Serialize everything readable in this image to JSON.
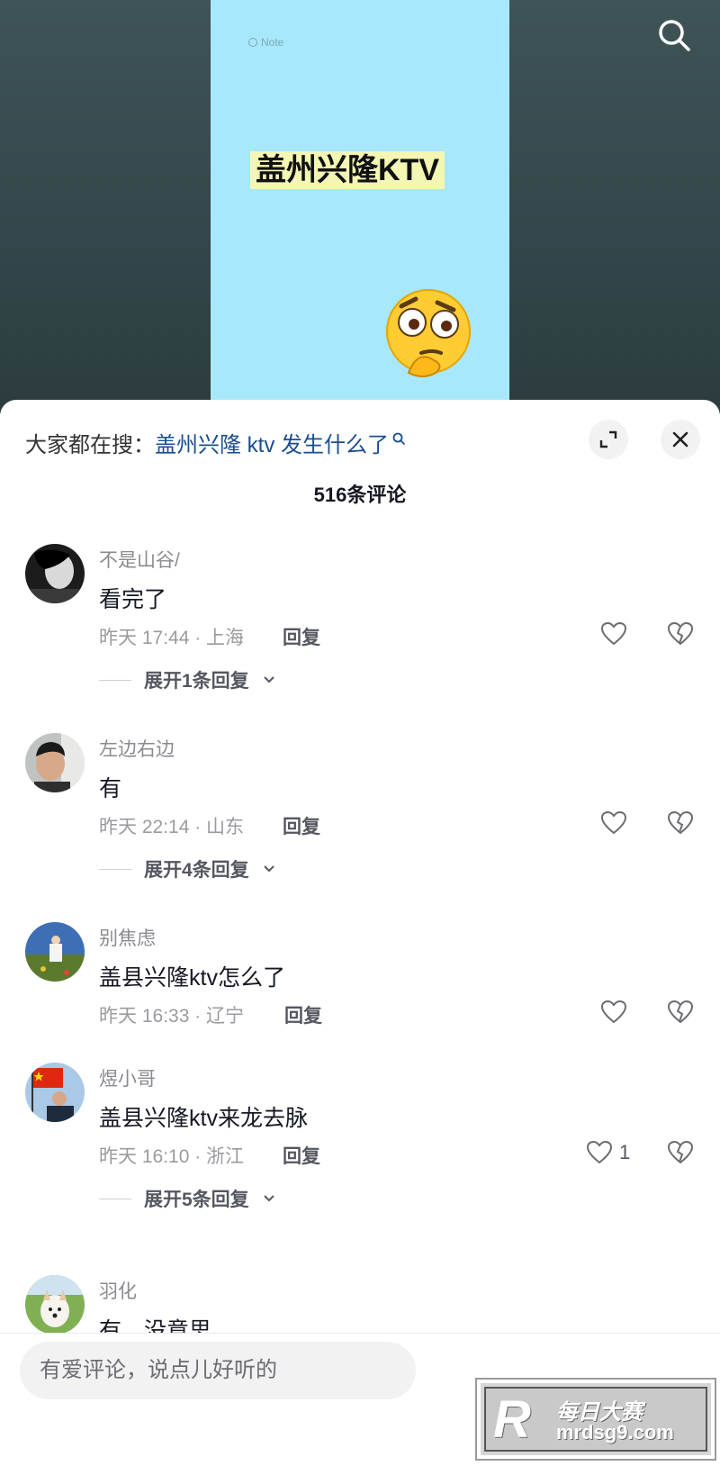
{
  "video": {
    "note_tag": "Note",
    "title": "盖州兴隆KTV",
    "emoji": "thinking-face"
  },
  "sheet": {
    "search_hint_prefix": "大家都在搜：",
    "search_hint_query": "盖州兴隆 ktv 发生什么了",
    "comment_count": "516条评论"
  },
  "comments": [
    {
      "username": "不是山谷/",
      "text": "看完了",
      "meta": "昨天 17:44 · 上海",
      "reply_label": "回复",
      "like_count": "",
      "expand_label": "展开1条回复",
      "avatar": "dark-portrait-avatar"
    },
    {
      "username": "左边右边",
      "text": "有",
      "meta": "昨天 22:14 · 山东",
      "reply_label": "回复",
      "like_count": "",
      "expand_label": "展开4条回复",
      "avatar": "man-portrait-avatar"
    },
    {
      "username": "别焦虑",
      "text": "盖县兴隆ktv怎么了",
      "meta": "昨天 16:33 · 辽宁",
      "reply_label": "回复",
      "like_count": "",
      "avatar": "field-landscape-avatar"
    },
    {
      "username": "煜小哥",
      "text": "盖县兴隆ktv来龙去脉",
      "meta": "昨天 16:10 · 浙江",
      "reply_label": "回复",
      "like_count": "1",
      "expand_label": "展开5条回复",
      "avatar": "flag-avatar"
    },
    {
      "username": "羽化",
      "text": "有，没意思",
      "avatar": "dog-avatar"
    }
  ],
  "input": {
    "placeholder": "有爱评论，说点儿好听的"
  },
  "watermark": {
    "logo": "R",
    "cn": "每日大赛",
    "url": "mrdsg9.com"
  },
  "colors": {
    "video_bg": "#3f5457",
    "phone_bg": "#a8e8fb",
    "link": "#1a4d8f",
    "secondary_text": "#8a8b91"
  }
}
